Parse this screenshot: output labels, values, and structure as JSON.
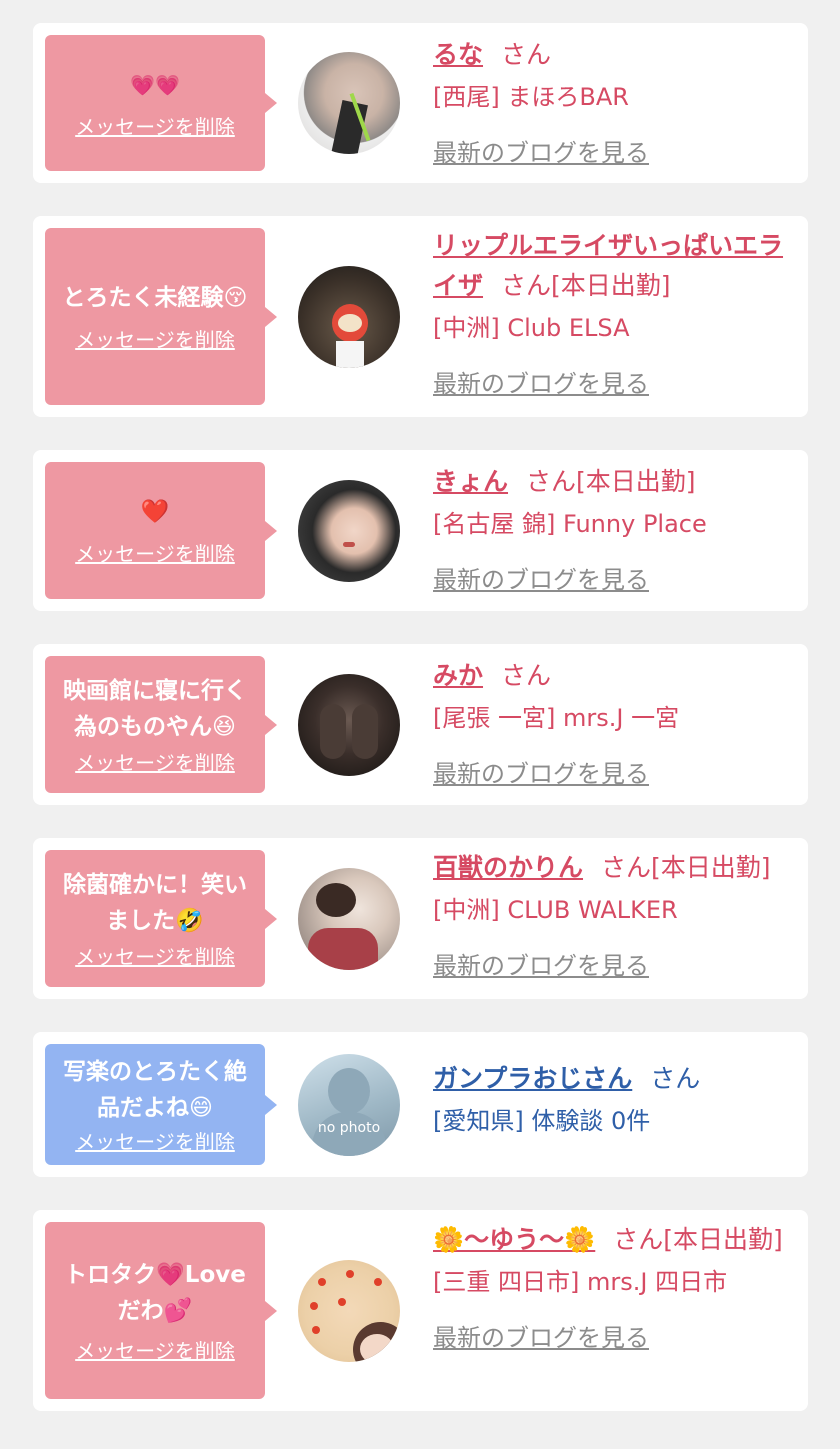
{
  "delete_label": "メッセージを削除",
  "blog_label": "最新のブログを見る",
  "cards": [
    {
      "message": "💗💗",
      "name": "るな",
      "suffix": "さん",
      "shop": "[西尾] まほろBAR",
      "blog": "最新のブログを見る"
    },
    {
      "message": "とろたく未経験😚",
      "name": "リップルエライザいっぱいエライザ",
      "suffix": "さん[本日出勤]",
      "shop": "[中洲] Club ELSA",
      "blog": "最新のブログを見る"
    },
    {
      "message": "❤️",
      "name": "きょん",
      "suffix": "さん[本日出勤]",
      "shop": "[名古屋 錦] Funny Place",
      "blog": "最新のブログを見る"
    },
    {
      "message": "映画館に寝に行く為のものやん😆",
      "name": "みか",
      "suffix": "さん",
      "shop": "[尾張 一宮] mrs.J 一宮",
      "blog": "最新のブログを見る"
    },
    {
      "message": "除菌確かに！笑いました🤣",
      "name": "百獣のかりん",
      "suffix": "さん[本日出勤]",
      "shop": "[中洲] CLUB WALKER",
      "blog": "最新のブログを見る"
    },
    {
      "message": "写楽のとろたく絶品だよね😄",
      "name": "ガンプラおじさん",
      "suffix": "さん",
      "shop": "[愛知県] 体験談 0件",
      "avatar_text": "no photo"
    },
    {
      "message": "トロタク💗Loveだわ💕",
      "name": "🌼〜ゆう〜🌼",
      "suffix": "さん[本日出勤]",
      "shop": "[三重 四日市] mrs.J 四日市",
      "blog": "最新のブログを見る"
    }
  ]
}
